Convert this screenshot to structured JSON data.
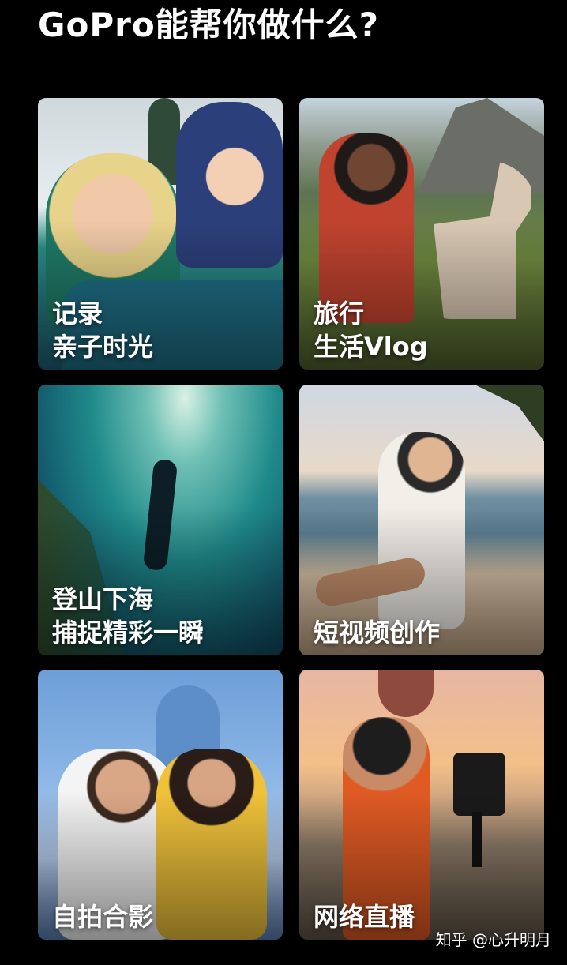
{
  "title": "GoPro能帮你做什么?",
  "cards": [
    {
      "line1": "记录",
      "line2": "亲子时光",
      "scene": "family-snow"
    },
    {
      "line1": "旅行",
      "line2": "生活Vlog",
      "scene": "travel-llama"
    },
    {
      "line1": "登山下海",
      "line2": "捕捉精彩一瞬",
      "scene": "underwater-diver"
    },
    {
      "line1": "短视频创作",
      "line2": "",
      "scene": "beach-swing"
    },
    {
      "line1": "自拍合影",
      "line2": "",
      "scene": "couple-selfie"
    },
    {
      "line1": "网络直播",
      "line2": "",
      "scene": "balloon-live"
    }
  ],
  "watermark": "知乎 @心升明月",
  "colors": {
    "background": "#000000",
    "text": "#ffffff"
  }
}
